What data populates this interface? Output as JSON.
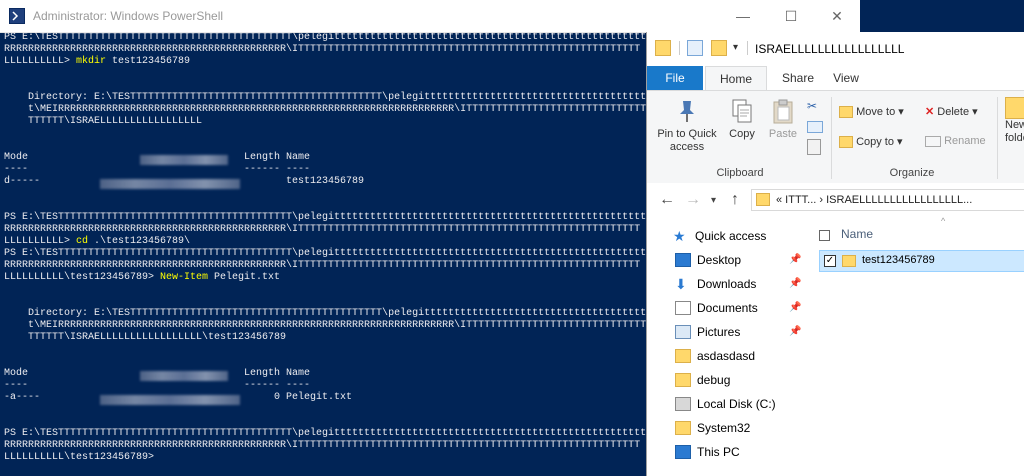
{
  "powershell": {
    "title": "Administrator: Windows PowerShell",
    "controls": {
      "minimize": "—",
      "maximize": "☐",
      "close": "✕"
    },
    "lines": [
      {
        "prefix": "PS E:\\TESTTTTTTTTTTTTTTTTTTTTTTTTTTTTTTTTTTTTTTT\\pelegittttttttttttttttttttttttttttttttttttttttttttttttttttt\\MEIRRRRRRRR",
        "cmd": "",
        "suffix": ""
      },
      {
        "prefix": "RRRRRRRRRRRRRRRRRRRRRRRRRRRRRRRRRRRRRRRRRRRRRRR\\ITTTTTTTTTTTTTTTTTTTTTTTTTTTTTTTTTTTTTTTTTTTTTTTTTTTTTTTTT",
        "cmd": "",
        "suffix": ""
      },
      {
        "prefix": "LLLLLLLLLL> ",
        "cmd": "mkdir",
        "suffix": " test123456789"
      },
      {
        "prefix": "",
        "cmd": "",
        "suffix": ""
      },
      {
        "prefix": "",
        "cmd": "",
        "suffix": ""
      },
      {
        "prefix": "    Directory: E:\\TESTTTTTTTTTTTTTTTTTTTTTTTTTTTTTTTTTTTTTTTTTT\\pelegittttttttttttttttttttttttttttttttttttttttttttt",
        "cmd": "",
        "suffix": ""
      },
      {
        "prefix": "    t\\MEIRRRRRRRRRRRRRRRRRRRRRRRRRRRRRRRRRRRRRRRRRRRRRRRRRRRRRRRRRRRRRRRRRR\\ITTTTTTTTTTTTTTTTTTTTTTTTTTTTTT",
        "cmd": "",
        "suffix": ""
      },
      {
        "prefix": "    TTTTTT\\ISRAELLLLLLLLLLLLLLLLL",
        "cmd": "",
        "suffix": ""
      },
      {
        "prefix": "",
        "cmd": "",
        "suffix": ""
      },
      {
        "prefix": "",
        "cmd": "",
        "suffix": ""
      },
      {
        "prefix": "Mode                                    Length Name",
        "cmd": "",
        "suffix": ""
      },
      {
        "prefix": "----                                    ------ ----",
        "cmd": "",
        "suffix": ""
      },
      {
        "prefix": "d-----                                         test123456789",
        "cmd": "",
        "suffix": ""
      },
      {
        "prefix": "",
        "cmd": "",
        "suffix": ""
      },
      {
        "prefix": "",
        "cmd": "",
        "suffix": ""
      },
      {
        "prefix": "PS E:\\TESTTTTTTTTTTTTTTTTTTTTTTTTTTTTTTTTTTTTTTT\\pelegittttttttttttttttttttttttttttttttttttttttttttttttttttt\\MEIRRRRRRRR",
        "cmd": "",
        "suffix": ""
      },
      {
        "prefix": "RRRRRRRRRRRRRRRRRRRRRRRRRRRRRRRRRRRRRRRRRRRRRRR\\ITTTTTTTTTTTTTTTTTTTTTTTTTTTTTTTTTTTTTTTTTTTTTTTTTTTTTTTTT",
        "cmd": "",
        "suffix": ""
      },
      {
        "prefix": "LLLLLLLLLL> ",
        "cmd": "cd",
        "suffix": " .\\test123456789\\"
      },
      {
        "prefix": "PS E:\\TESTTTTTTTTTTTTTTTTTTTTTTTTTTTTTTTTTTTTTTT\\pelegittttttttttttttttttttttttttttttttttttttttttttttttttttt\\MEIRRRRRRRR",
        "cmd": "",
        "suffix": ""
      },
      {
        "prefix": "RRRRRRRRRRRRRRRRRRRRRRRRRRRRRRRRRRRRRRRRRRRRRRR\\ITTTTTTTTTTTTTTTTTTTTTTTTTTTTTTTTTTTTTTTTTTTTTTTTTTTTTTTTT",
        "cmd": "",
        "suffix": ""
      },
      {
        "prefix": "LLLLLLLLLL\\test123456789> ",
        "cmd": "New-Item",
        "suffix": " Pelegit.txt"
      },
      {
        "prefix": "",
        "cmd": "",
        "suffix": ""
      },
      {
        "prefix": "",
        "cmd": "",
        "suffix": ""
      },
      {
        "prefix": "    Directory: E:\\TESTTTTTTTTTTTTTTTTTTTTTTTTTTTTTTTTTTTTTTTTTT\\pelegittttttttttttttttttttttttttttttttttttttttttttt",
        "cmd": "",
        "suffix": ""
      },
      {
        "prefix": "    t\\MEIRRRRRRRRRRRRRRRRRRRRRRRRRRRRRRRRRRRRRRRRRRRRRRRRRRRRRRRRRRRRRRRRRR\\ITTTTTTTTTTTTTTTTTTTTTTTTTTTTTT",
        "cmd": "",
        "suffix": ""
      },
      {
        "prefix": "    TTTTTT\\ISRAELLLLLLLLLLLLLLLLL\\test123456789",
        "cmd": "",
        "suffix": ""
      },
      {
        "prefix": "",
        "cmd": "",
        "suffix": ""
      },
      {
        "prefix": "",
        "cmd": "",
        "suffix": ""
      },
      {
        "prefix": "Mode                                    Length Name",
        "cmd": "",
        "suffix": ""
      },
      {
        "prefix": "----                                    ------ ----",
        "cmd": "",
        "suffix": ""
      },
      {
        "prefix": "-a----                                       0 Pelegit.txt",
        "cmd": "",
        "suffix": ""
      },
      {
        "prefix": "",
        "cmd": "",
        "suffix": ""
      },
      {
        "prefix": "",
        "cmd": "",
        "suffix": ""
      },
      {
        "prefix": "PS E:\\TESTTTTTTTTTTTTTTTTTTTTTTTTTTTTTTTTTTTTTTT\\pelegittttttttttttttttttttttttttttttttttttttttttttttttttttt\\MEIRRRRRRRR",
        "cmd": "",
        "suffix": ""
      },
      {
        "prefix": "RRRRRRRRRRRRRRRRRRRRRRRRRRRRRRRRRRRRRRRRRRRRRRR\\ITTTTTTTTTTTTTTTTTTTTTTTTTTTTTTTTTTTTTTTTTTTTTTTTTTTTTTTTT",
        "cmd": "",
        "suffix": ""
      },
      {
        "prefix": "LLLLLLLLLL\\test123456789>",
        "cmd": "",
        "suffix": ""
      }
    ]
  },
  "explorer": {
    "title": "ISRAELLLLLLLLLLLLLLLLL",
    "tabs": {
      "file": "File",
      "home": "Home",
      "share": "Share",
      "view": "View"
    },
    "ribbon": {
      "pin_label": "Pin to Quick access",
      "copy_label": "Copy",
      "paste_label": "Paste",
      "move_to": "Move to",
      "copy_to": "Copy to",
      "delete": "Delete",
      "rename": "Rename",
      "new_folder": "New folder",
      "group_clipboard": "Clipboard",
      "group_organize": "Organize"
    },
    "address": {
      "path": "«  ITTT...  ›  ISRAELLLLLLLLLLLLLLLLL..."
    },
    "nav": [
      {
        "label": "Quick access",
        "icon": "star-icon"
      },
      {
        "label": "Desktop",
        "icon": "desktop-icon",
        "pinned": true
      },
      {
        "label": "Downloads",
        "icon": "download-icon",
        "pinned": true
      },
      {
        "label": "Documents",
        "icon": "documents-icon",
        "pinned": true
      },
      {
        "label": "Pictures",
        "icon": "pictures-icon",
        "pinned": true
      },
      {
        "label": "asdasdasd",
        "icon": "folder-icon"
      },
      {
        "label": "debug",
        "icon": "folder-icon"
      },
      {
        "label": "Local Disk (C:)",
        "icon": "drive-icon"
      },
      {
        "label": "System32",
        "icon": "folder-icon"
      },
      {
        "label": "This PC",
        "icon": "computer-icon"
      }
    ],
    "files": {
      "header_name": "Name",
      "items": [
        {
          "name": "test123456789",
          "selected": true
        }
      ]
    }
  }
}
